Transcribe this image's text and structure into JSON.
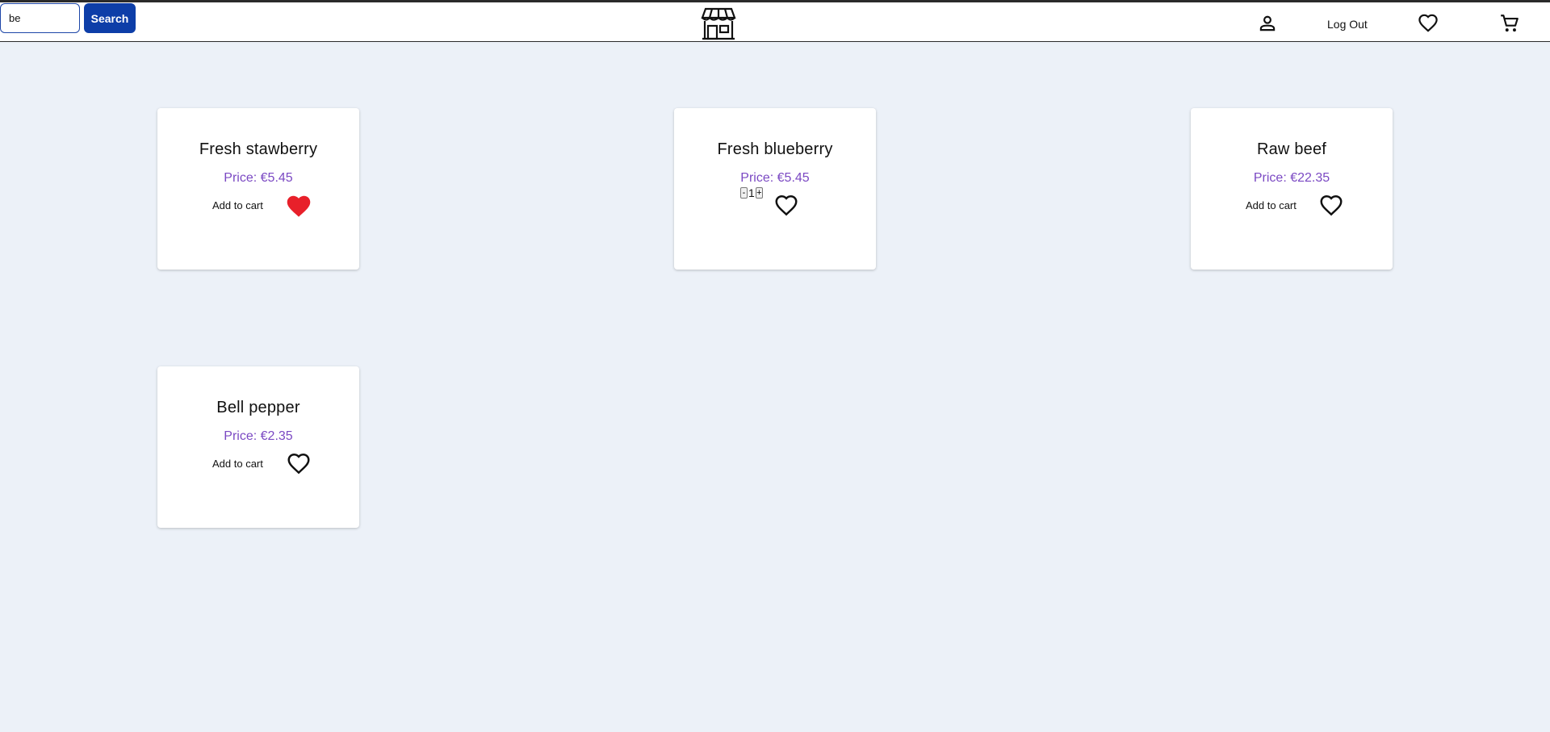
{
  "search": {
    "value": "be",
    "button_label": "Search"
  },
  "nav": {
    "logout_label": "Log Out",
    "icons": [
      "user-icon",
      "heart-icon",
      "cart-icon"
    ]
  },
  "brand": {
    "logo": "storefront-icon"
  },
  "colors": {
    "accent": "#0d3ea8",
    "price": "#7b49c3",
    "favorite": "#e8202a",
    "background": "#ecf1f8"
  },
  "products": [
    {
      "name": "Fresh stawberry",
      "price": "Price: €5.45",
      "add_label": "Add to cart",
      "favorited": true
    },
    {
      "name": "Fresh blueberry",
      "price": "Price: €5.45",
      "quantity": {
        "minus": "-",
        "value": "1",
        "plus": "+"
      },
      "favorited": false
    },
    {
      "name": "Raw beef",
      "price": "Price: €22.35",
      "add_label": "Add to cart",
      "favorited": false
    },
    {
      "name": "Bell pepper",
      "price": "Price: €2.35",
      "add_label": "Add to cart",
      "favorited": false
    }
  ]
}
